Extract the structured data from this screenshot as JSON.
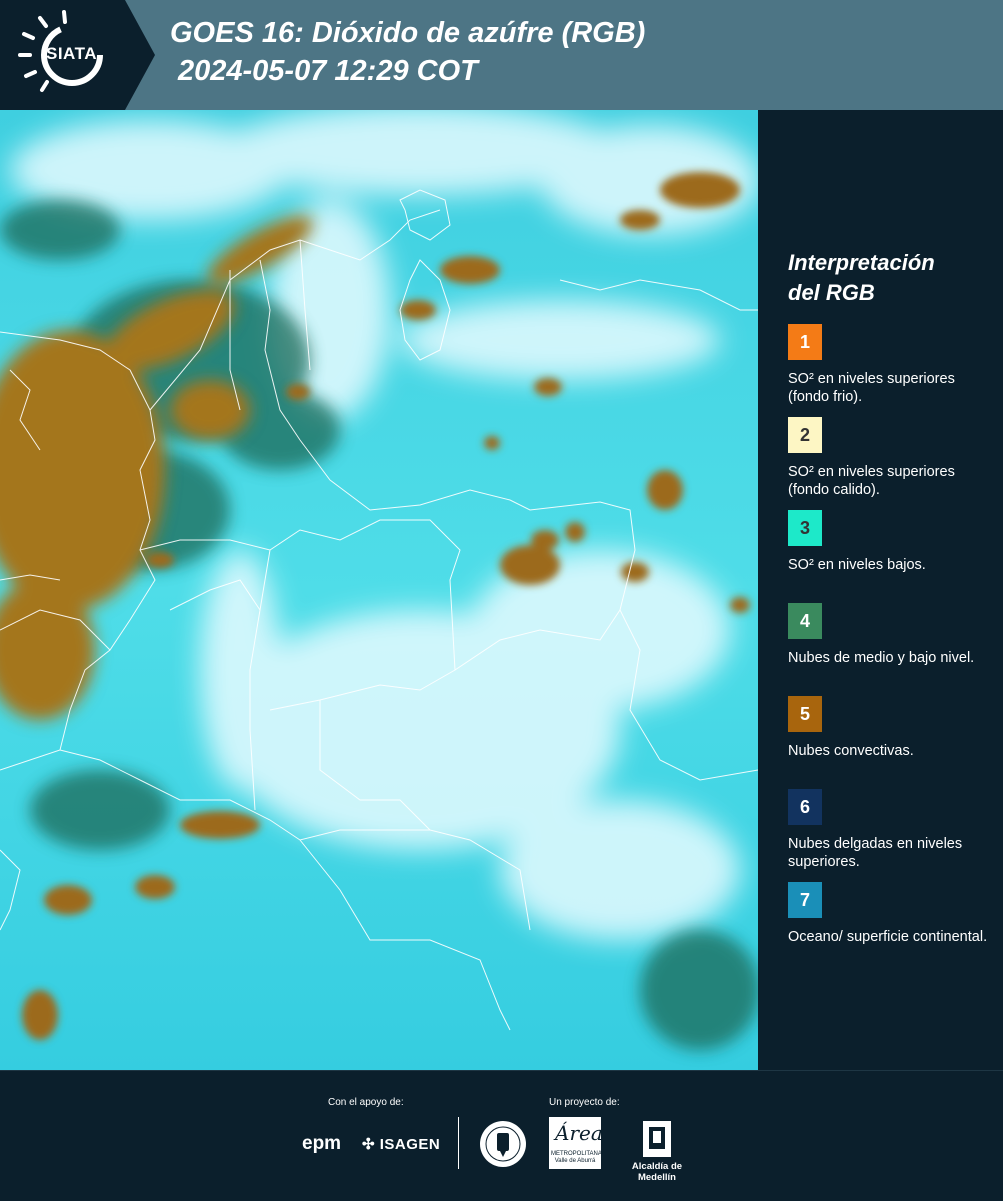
{
  "header": {
    "logo_text": "SIATA",
    "title": "GOES 16: Dióxido de azúfre (RGB)",
    "subtitle": "2024-05-07 12:29 COT"
  },
  "legend": {
    "title_line1": "Interpretación",
    "title_line2": "del RGB",
    "items": [
      {
        "number": "1",
        "color": "#f47b16",
        "text": "SO² en niveles superiores (fondo frio)."
      },
      {
        "number": "2",
        "color": "#fdf6c4",
        "text": "SO² en niveles superiores (fondo calido)."
      },
      {
        "number": "3",
        "color": "#1de9c9",
        "text": "SO² en niveles bajos."
      },
      {
        "number": "4",
        "color": "#3a8a5e",
        "text": "Nubes de medio y bajo nivel."
      },
      {
        "number": "5",
        "color": "#a8650d",
        "text": "Nubes convectivas."
      },
      {
        "number": "6",
        "color": "#12335f",
        "text": "Nubes delgadas en niveles superiores."
      },
      {
        "number": "7",
        "color": "#1a8fb8",
        "text": "Oceano/ superficie continental."
      }
    ]
  },
  "footer": {
    "support_label": "Con el apoyo de:",
    "project_label": "Un proyecto de:",
    "epm": "epm",
    "isagen": "ISAGEN",
    "area_logo_text": "Área",
    "area_logo_sub": "METROPOLITANA Valle de Aburrá",
    "alcaldia": "Alcaldía de Medellín"
  }
}
